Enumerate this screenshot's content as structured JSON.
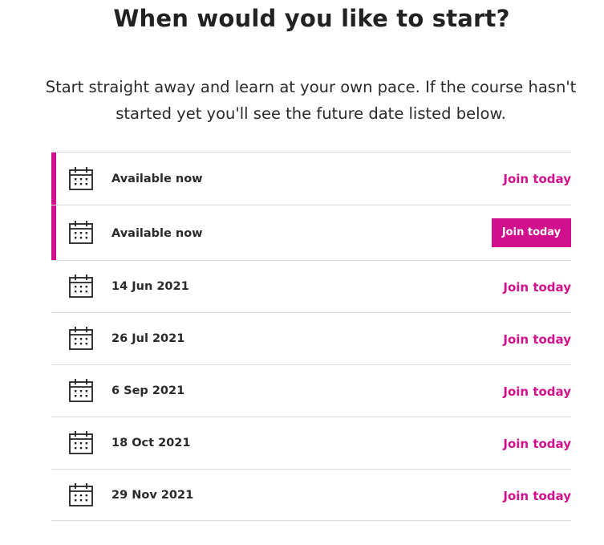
{
  "heading": "When would you like to start?",
  "intro": "Start straight away and learn at your own pace. If the course hasn't started yet you'll see the future date listed below.",
  "accent_color": "#d20f8c",
  "icon": "calendar-icon",
  "runs": [
    {
      "date": "Available now",
      "action": "Join today"
    },
    {
      "date": "Available now",
      "action": "Join today"
    },
    {
      "date": "14 Jun 2021",
      "action": "Join today"
    },
    {
      "date": "26 Jul 2021",
      "action": "Join today"
    },
    {
      "date": "6 Sep 2021",
      "action": "Join today"
    },
    {
      "date": "18 Oct 2021",
      "action": "Join today"
    },
    {
      "date": "29 Nov 2021",
      "action": "Join today"
    }
  ]
}
